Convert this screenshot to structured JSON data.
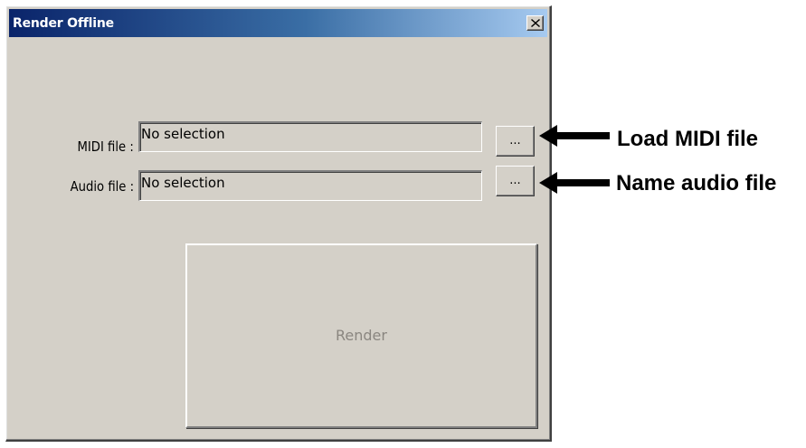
{
  "window": {
    "title": "Render Offline",
    "close_glyph": "✕"
  },
  "fields": {
    "midi": {
      "label": "MIDI file :",
      "value": "No selection",
      "browse_label": "..."
    },
    "audio": {
      "label": "Audio file :",
      "value": "No selection",
      "browse_label": "..."
    }
  },
  "render": {
    "label": "Render",
    "state": "disabled"
  },
  "annotations": {
    "midi": "Load MIDI file",
    "audio": "Name audio file"
  },
  "colors": {
    "dialog_bg": "#d4d0c8",
    "title_start": "#0a246a",
    "title_end": "#a6caf0",
    "disabled_text": "#8a8680"
  },
  "icons": [
    "close-icon",
    "arrow-left-icon"
  ]
}
